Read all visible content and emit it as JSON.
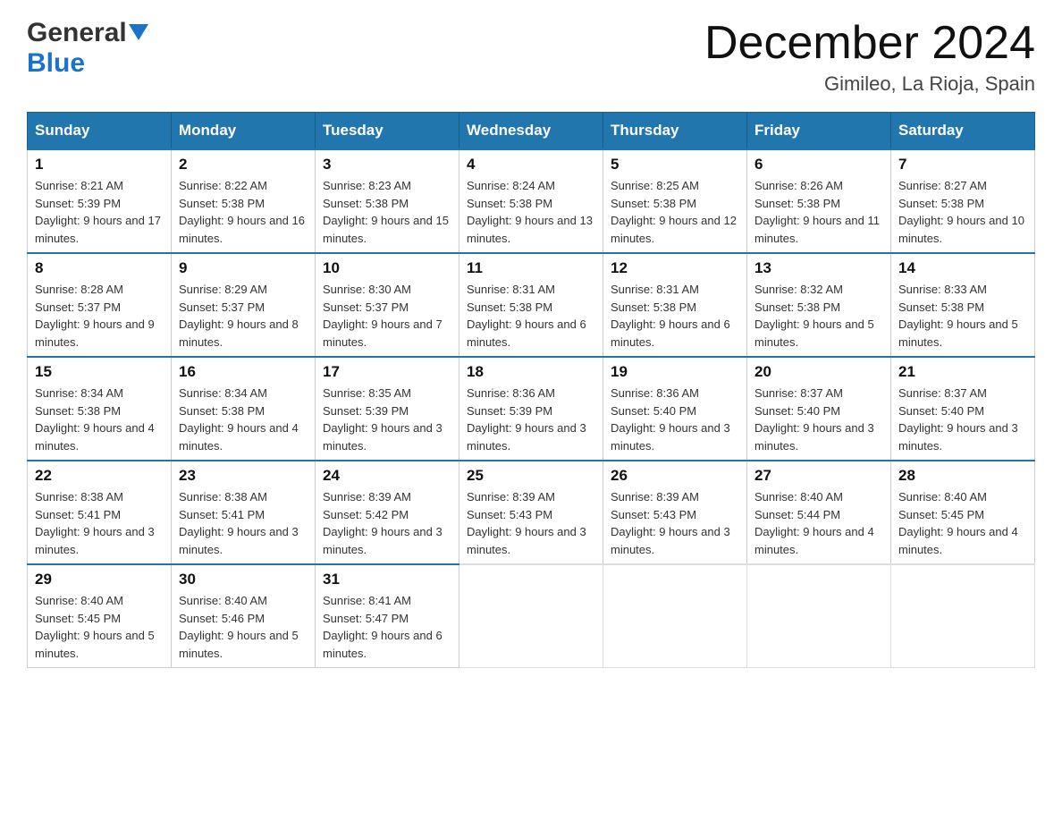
{
  "header": {
    "logo_general": "General",
    "logo_blue": "Blue",
    "title": "December 2024",
    "subtitle": "Gimileo, La Rioja, Spain"
  },
  "days_of_week": [
    "Sunday",
    "Monday",
    "Tuesday",
    "Wednesday",
    "Thursday",
    "Friday",
    "Saturday"
  ],
  "weeks": [
    [
      {
        "day": "1",
        "sunrise": "Sunrise: 8:21 AM",
        "sunset": "Sunset: 5:39 PM",
        "daylight": "Daylight: 9 hours and 17 minutes."
      },
      {
        "day": "2",
        "sunrise": "Sunrise: 8:22 AM",
        "sunset": "Sunset: 5:38 PM",
        "daylight": "Daylight: 9 hours and 16 minutes."
      },
      {
        "day": "3",
        "sunrise": "Sunrise: 8:23 AM",
        "sunset": "Sunset: 5:38 PM",
        "daylight": "Daylight: 9 hours and 15 minutes."
      },
      {
        "day": "4",
        "sunrise": "Sunrise: 8:24 AM",
        "sunset": "Sunset: 5:38 PM",
        "daylight": "Daylight: 9 hours and 13 minutes."
      },
      {
        "day": "5",
        "sunrise": "Sunrise: 8:25 AM",
        "sunset": "Sunset: 5:38 PM",
        "daylight": "Daylight: 9 hours and 12 minutes."
      },
      {
        "day": "6",
        "sunrise": "Sunrise: 8:26 AM",
        "sunset": "Sunset: 5:38 PM",
        "daylight": "Daylight: 9 hours and 11 minutes."
      },
      {
        "day": "7",
        "sunrise": "Sunrise: 8:27 AM",
        "sunset": "Sunset: 5:38 PM",
        "daylight": "Daylight: 9 hours and 10 minutes."
      }
    ],
    [
      {
        "day": "8",
        "sunrise": "Sunrise: 8:28 AM",
        "sunset": "Sunset: 5:37 PM",
        "daylight": "Daylight: 9 hours and 9 minutes."
      },
      {
        "day": "9",
        "sunrise": "Sunrise: 8:29 AM",
        "sunset": "Sunset: 5:37 PM",
        "daylight": "Daylight: 9 hours and 8 minutes."
      },
      {
        "day": "10",
        "sunrise": "Sunrise: 8:30 AM",
        "sunset": "Sunset: 5:37 PM",
        "daylight": "Daylight: 9 hours and 7 minutes."
      },
      {
        "day": "11",
        "sunrise": "Sunrise: 8:31 AM",
        "sunset": "Sunset: 5:38 PM",
        "daylight": "Daylight: 9 hours and 6 minutes."
      },
      {
        "day": "12",
        "sunrise": "Sunrise: 8:31 AM",
        "sunset": "Sunset: 5:38 PM",
        "daylight": "Daylight: 9 hours and 6 minutes."
      },
      {
        "day": "13",
        "sunrise": "Sunrise: 8:32 AM",
        "sunset": "Sunset: 5:38 PM",
        "daylight": "Daylight: 9 hours and 5 minutes."
      },
      {
        "day": "14",
        "sunrise": "Sunrise: 8:33 AM",
        "sunset": "Sunset: 5:38 PM",
        "daylight": "Daylight: 9 hours and 5 minutes."
      }
    ],
    [
      {
        "day": "15",
        "sunrise": "Sunrise: 8:34 AM",
        "sunset": "Sunset: 5:38 PM",
        "daylight": "Daylight: 9 hours and 4 minutes."
      },
      {
        "day": "16",
        "sunrise": "Sunrise: 8:34 AM",
        "sunset": "Sunset: 5:38 PM",
        "daylight": "Daylight: 9 hours and 4 minutes."
      },
      {
        "day": "17",
        "sunrise": "Sunrise: 8:35 AM",
        "sunset": "Sunset: 5:39 PM",
        "daylight": "Daylight: 9 hours and 3 minutes."
      },
      {
        "day": "18",
        "sunrise": "Sunrise: 8:36 AM",
        "sunset": "Sunset: 5:39 PM",
        "daylight": "Daylight: 9 hours and 3 minutes."
      },
      {
        "day": "19",
        "sunrise": "Sunrise: 8:36 AM",
        "sunset": "Sunset: 5:40 PM",
        "daylight": "Daylight: 9 hours and 3 minutes."
      },
      {
        "day": "20",
        "sunrise": "Sunrise: 8:37 AM",
        "sunset": "Sunset: 5:40 PM",
        "daylight": "Daylight: 9 hours and 3 minutes."
      },
      {
        "day": "21",
        "sunrise": "Sunrise: 8:37 AM",
        "sunset": "Sunset: 5:40 PM",
        "daylight": "Daylight: 9 hours and 3 minutes."
      }
    ],
    [
      {
        "day": "22",
        "sunrise": "Sunrise: 8:38 AM",
        "sunset": "Sunset: 5:41 PM",
        "daylight": "Daylight: 9 hours and 3 minutes."
      },
      {
        "day": "23",
        "sunrise": "Sunrise: 8:38 AM",
        "sunset": "Sunset: 5:41 PM",
        "daylight": "Daylight: 9 hours and 3 minutes."
      },
      {
        "day": "24",
        "sunrise": "Sunrise: 8:39 AM",
        "sunset": "Sunset: 5:42 PM",
        "daylight": "Daylight: 9 hours and 3 minutes."
      },
      {
        "day": "25",
        "sunrise": "Sunrise: 8:39 AM",
        "sunset": "Sunset: 5:43 PM",
        "daylight": "Daylight: 9 hours and 3 minutes."
      },
      {
        "day": "26",
        "sunrise": "Sunrise: 8:39 AM",
        "sunset": "Sunset: 5:43 PM",
        "daylight": "Daylight: 9 hours and 3 minutes."
      },
      {
        "day": "27",
        "sunrise": "Sunrise: 8:40 AM",
        "sunset": "Sunset: 5:44 PM",
        "daylight": "Daylight: 9 hours and 4 minutes."
      },
      {
        "day": "28",
        "sunrise": "Sunrise: 8:40 AM",
        "sunset": "Sunset: 5:45 PM",
        "daylight": "Daylight: 9 hours and 4 minutes."
      }
    ],
    [
      {
        "day": "29",
        "sunrise": "Sunrise: 8:40 AM",
        "sunset": "Sunset: 5:45 PM",
        "daylight": "Daylight: 9 hours and 5 minutes."
      },
      {
        "day": "30",
        "sunrise": "Sunrise: 8:40 AM",
        "sunset": "Sunset: 5:46 PM",
        "daylight": "Daylight: 9 hours and 5 minutes."
      },
      {
        "day": "31",
        "sunrise": "Sunrise: 8:41 AM",
        "sunset": "Sunset: 5:47 PM",
        "daylight": "Daylight: 9 hours and 6 minutes."
      },
      null,
      null,
      null,
      null
    ]
  ],
  "colors": {
    "header_bg": "#2176ae",
    "accent_blue": "#1a73c9"
  }
}
